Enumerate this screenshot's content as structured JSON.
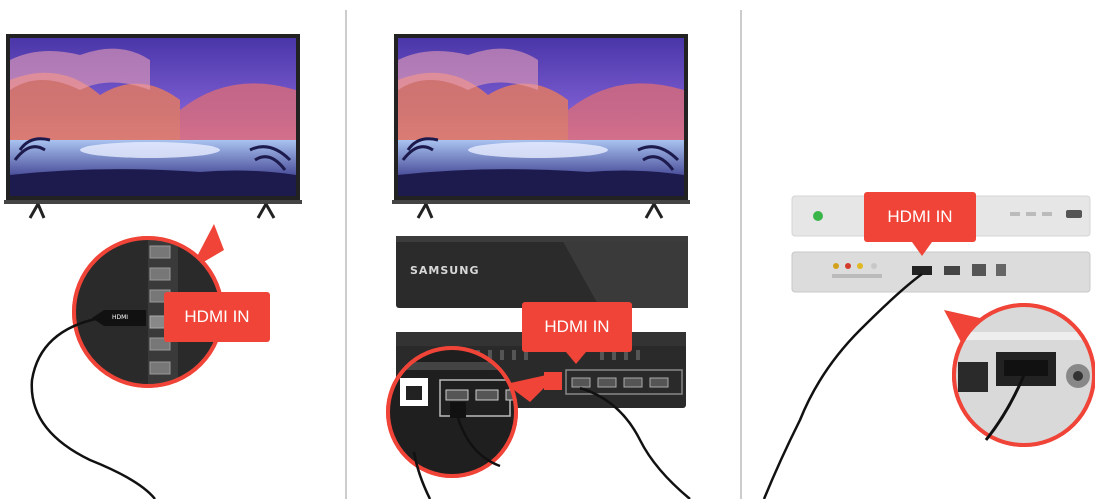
{
  "panels": [
    {
      "id": "tv-port",
      "callout_label": "HDMI IN",
      "port_text": "HDMI"
    },
    {
      "id": "one-connect",
      "callout_label": "HDMI IN",
      "brand_text": "SAMSUNG"
    },
    {
      "id": "external-device",
      "callout_label": "HDMI IN"
    }
  ],
  "colors": {
    "callout_red": "#ef4437",
    "cable": "#111111",
    "tv_frame": "#222222",
    "divider": "#cccccc"
  }
}
